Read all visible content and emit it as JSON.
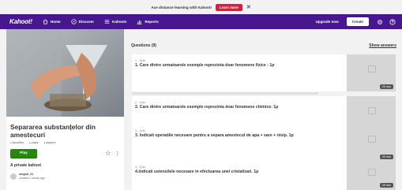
{
  "banner": {
    "text": "Ace distance learning with Kahoot!",
    "cta": "Learn more",
    "close": "✕"
  },
  "nav": {
    "logo": "Kahoot!",
    "links": [
      "Home",
      "Discover",
      "Kahoots",
      "Reports"
    ],
    "upgrade": "Upgrade now",
    "create": "Create"
  },
  "kahoot": {
    "title": "Separarea substanțelor din amestecuri",
    "favorites": "favorites",
    "plays": "plays",
    "players": "players",
    "play": "Play",
    "visibility": "A private kahoot",
    "owner": "sergiur_21",
    "created": "created 1 month ago"
  },
  "questions": {
    "count_label": "Questions (9)",
    "show_answers": "Show answers",
    "items": [
      {
        "type": "1 - Quiz",
        "text": "1. Care dintre urmatoarele exemple reprezinta doar fenomene fizice : 1p",
        "time": "20 sec"
      },
      {
        "type": "2 - Quiz",
        "text": "2. Care dintre urmatoarele exemple reprezinta doar fenomene chimice: 1p",
        "time": "20 sec"
      },
      {
        "type": "3 - Quiz",
        "text": "3. Indicati operatiile necesare pentru a separa amestecul de apa + sare + nisip. 1p",
        "time": "20 sec"
      },
      {
        "type": "4 - Quiz",
        "text": "4.indicati ustensilele necesare in efectuarea unei cristalizari. 1p",
        "time": "20 sec"
      }
    ]
  },
  "colors": {
    "nav": "#46178f",
    "play": "#26890c",
    "learn": "#e21b3c"
  }
}
